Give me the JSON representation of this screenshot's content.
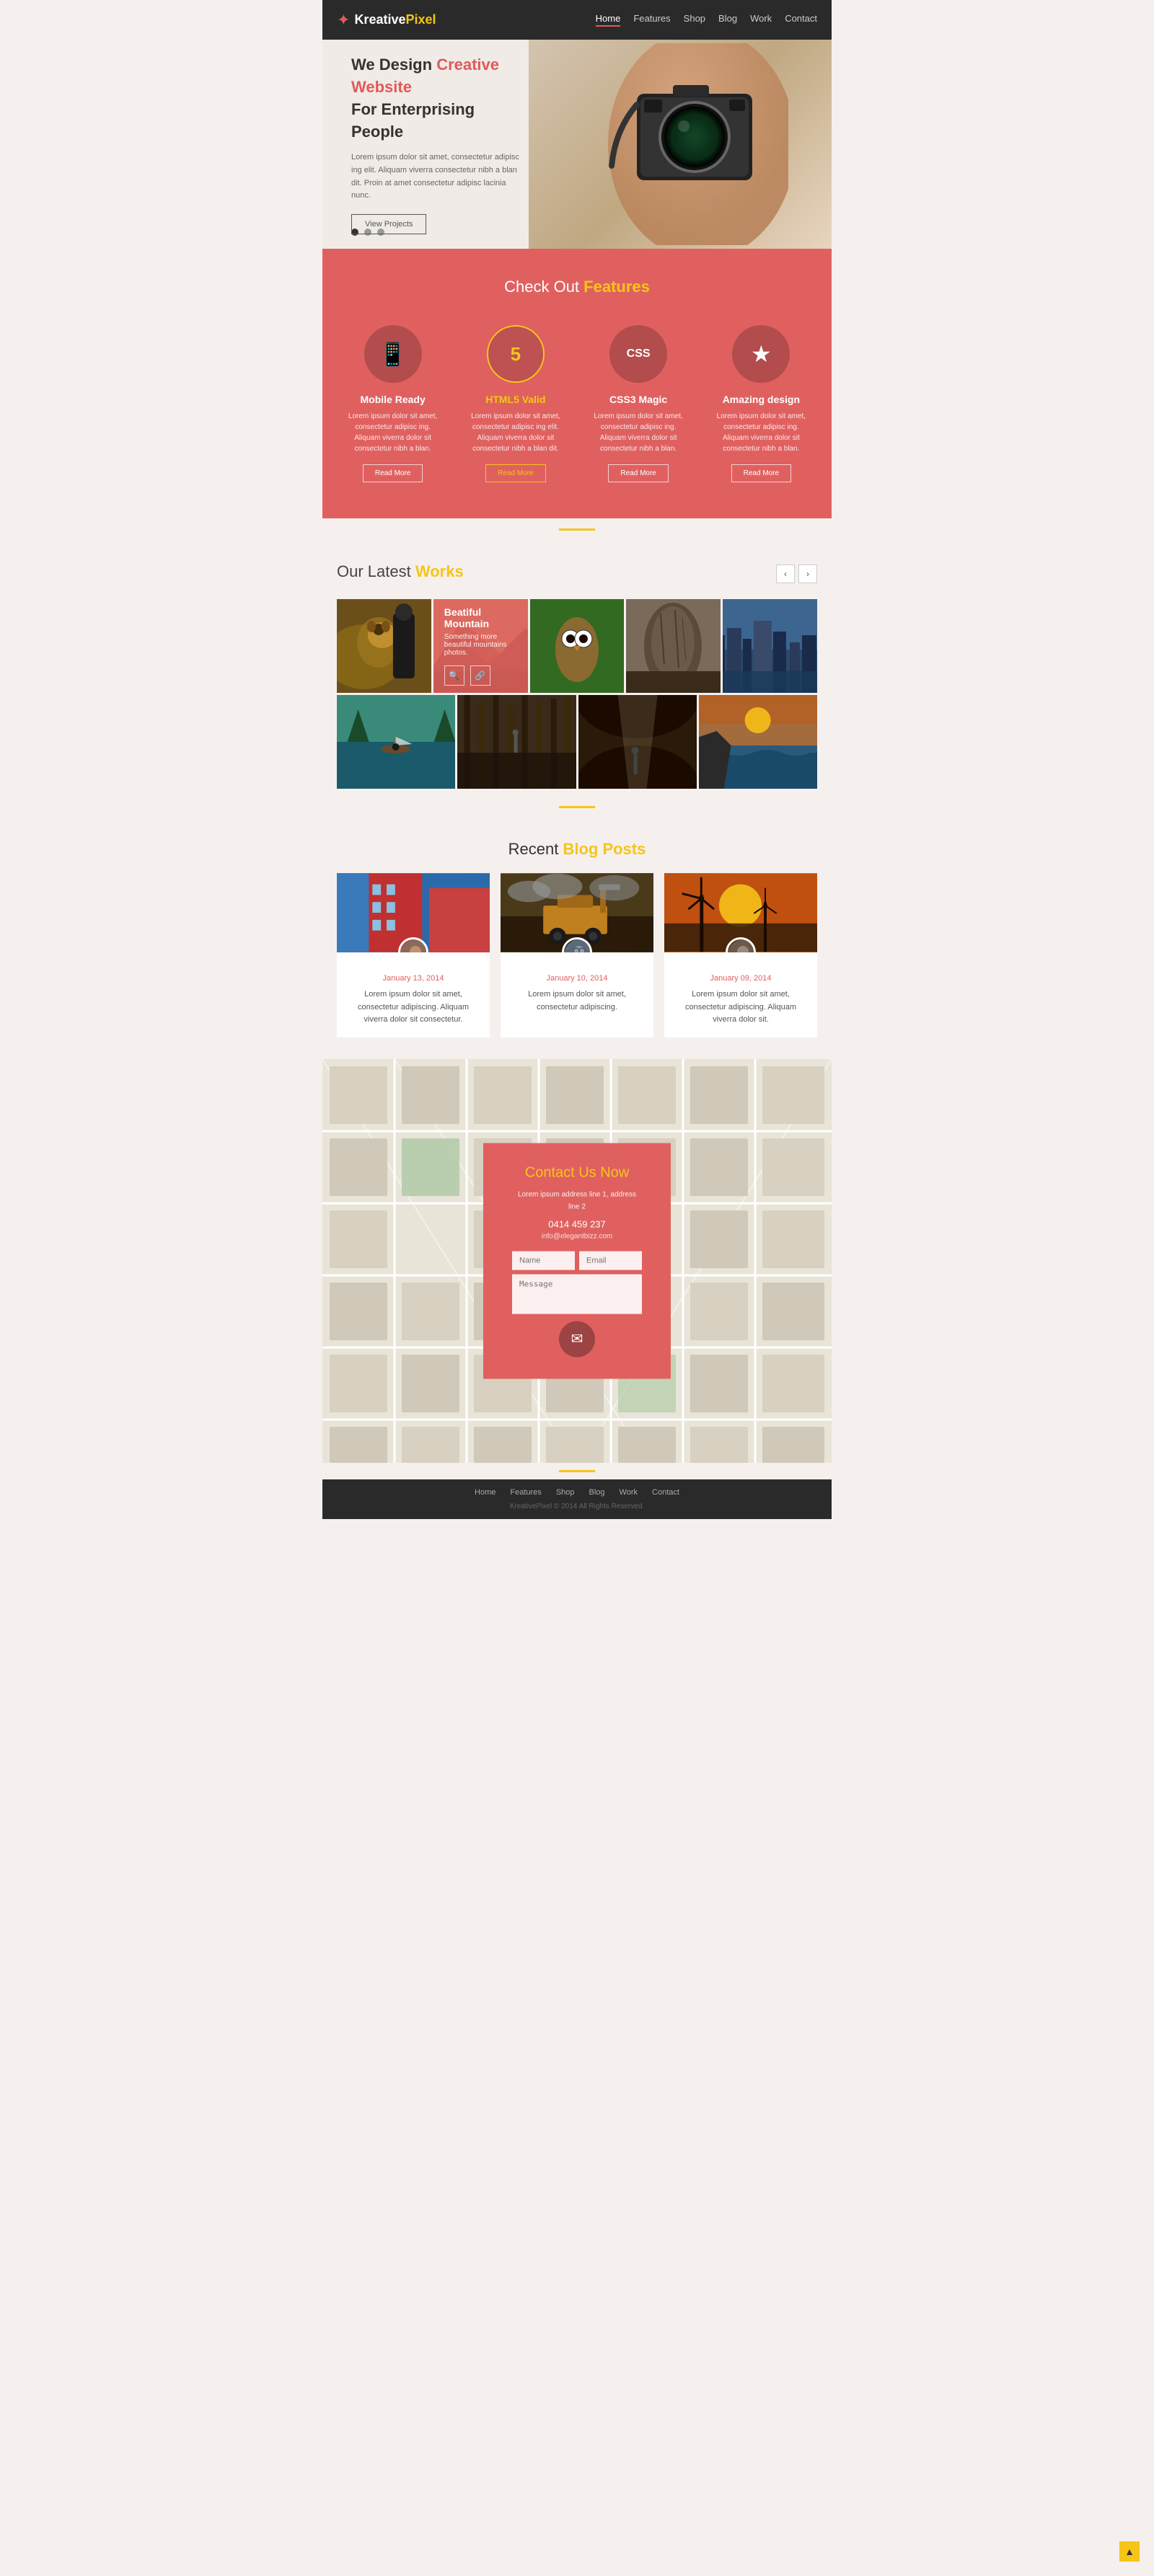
{
  "nav": {
    "logo_kreative": "Kreative",
    "logo_pixel": "Pixel",
    "links": [
      {
        "label": "Home",
        "active": true
      },
      {
        "label": "Features",
        "active": false
      },
      {
        "label": "Shop",
        "active": false
      },
      {
        "label": "Blog",
        "active": false
      },
      {
        "label": "Work",
        "active": false
      },
      {
        "label": "Contact",
        "active": false
      }
    ]
  },
  "hero": {
    "line1": "We Design ",
    "creative": "Creative Website",
    "line2": "For Enterprising People",
    "desc": "Lorem ipsum dolor sit amet, consectetur adipisc ing elit. Aliquam viverra consectetur nibh a blan dit. Proin at amet consectetur adipisc lacinia nunc.",
    "cta": "View Projects"
  },
  "features": {
    "section_title_normal": "Check Out ",
    "section_title_bold": "Features",
    "cards": [
      {
        "icon": "📱",
        "title": "Mobile Ready",
        "highlight": false,
        "desc": "Lorem ipsum dolor sit amet, consectetur adipisc ing. Aliquam viverra  dolor sit consectetur nibh a blan.",
        "btn": "Read More"
      },
      {
        "icon": "5",
        "title": "HTML5 Valid",
        "highlight": true,
        "desc": "Lorem ipsum dolor sit amet, consectetur adipisc ing elit. Aliquam viverra  dolor sit consectetur nibh a blan dit.",
        "btn": "Read More"
      },
      {
        "icon": "CSS",
        "title": "CSS3 Magic",
        "highlight": false,
        "desc": "Lorem ipsum dolor sit amet, consectetur adipisc ing. Aliquam viverra  dolor sit consectetur nibh a blan.",
        "btn": "Read More"
      },
      {
        "icon": "★",
        "title": "Amazing design",
        "highlight": false,
        "desc": "Lorem ipsum dolor sit amet, consectetur adipisc ing. Aliquam viverra  dolor sit consectetur nibh a blan.",
        "btn": "Read More"
      }
    ]
  },
  "works": {
    "title_normal": "Our Latest ",
    "title_bold": "Works",
    "items": [
      {
        "bg": "bg-dog",
        "label": "Dog Photo"
      },
      {
        "bg": "bg-mountain",
        "label": "Beatiful Mountain",
        "desc": "Something more beautiful mountains photos.",
        "featured": true
      },
      {
        "bg": "bg-owl",
        "label": "Owl Photo"
      },
      {
        "bg": "bg-rock",
        "label": "Rock Photo"
      },
      {
        "bg": "bg-city",
        "label": "City Photo"
      },
      {
        "bg": "bg-lake",
        "label": "Lake Photo"
      },
      {
        "bg": "bg-wood",
        "label": "Wood Photo"
      },
      {
        "bg": "bg-cave",
        "label": "Cave Photo"
      },
      {
        "bg": "bg-wave",
        "label": "Wave Photo"
      }
    ],
    "featured_title": "Beatiful Mountain",
    "featured_desc": "Something more beautiful mountains photos."
  },
  "blog": {
    "title_normal": "Recent ",
    "title_bold": "Blog Posts",
    "posts": [
      {
        "date": "January 13, 2014",
        "text": "Lorem ipsum dolor sit amet, consectetur adipiscing. Aliquam viverra  dolor sit consectetur.",
        "img_bg": "blog-img-1"
      },
      {
        "date": "January 10, 2014",
        "text": "Lorem ipsum dolor sit amet, consectetur adipiscing.",
        "img_bg": "blog-img-2"
      },
      {
        "date": "January 09, 2014",
        "text": "Lorem ipsum dolor sit amet, consectetur adipiscing. Aliquam viverra  dolor sit.",
        "img_bg": "blog-img-3"
      }
    ]
  },
  "contact": {
    "title": "Contact Us Now",
    "address": "Lorem ipsum address line 1, address line 2",
    "phone": "0414 459 237",
    "email": "info@elegantbizz.com",
    "name_placeholder": "Name",
    "email_placeholder": "Email",
    "message_placeholder": "Message"
  },
  "footer": {
    "links": [
      "Home",
      "Features",
      "Shop",
      "Blog",
      "Work",
      "Contact"
    ],
    "copy": "KreativePixel © 2014 All Rights Reserved."
  }
}
